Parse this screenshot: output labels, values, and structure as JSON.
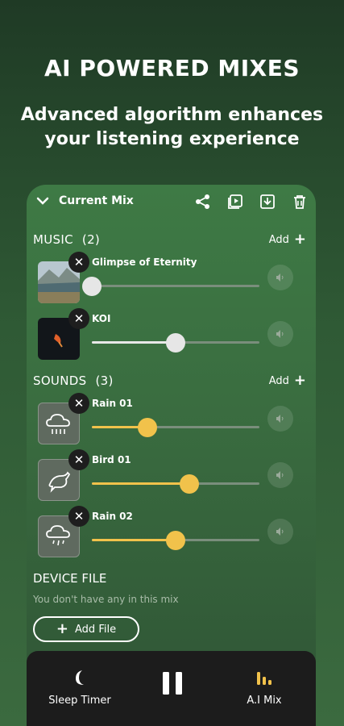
{
  "headline": "AI POWERED MIXES",
  "subhead_line1": "Advanced algorithm enhances",
  "subhead_line2": "your listening experience",
  "panel": {
    "title": "Current Mix",
    "header_icons": [
      "share-icon",
      "playlist-icon",
      "download-icon",
      "trash-icon"
    ]
  },
  "music": {
    "label": "MUSIC",
    "count": "(2)",
    "add_label": "Add",
    "tracks": [
      {
        "name": "Glimpse of Eternity",
        "volume": 0.0
      },
      {
        "name": "KOI",
        "volume": 0.5
      }
    ]
  },
  "sounds": {
    "label": "SOUNDS",
    "count": "(3)",
    "add_label": "Add",
    "tracks": [
      {
        "name": "Rain 01",
        "volume": 0.33,
        "icon": "cloud-rain-icon"
      },
      {
        "name": "Bird 01",
        "volume": 0.58,
        "icon": "bird-icon"
      },
      {
        "name": "Rain 02",
        "volume": 0.5,
        "icon": "cloud-drizzle-icon"
      }
    ]
  },
  "device_file": {
    "label": "DEVICE FILE",
    "empty_text": "You don't have any in this mix",
    "add_label": "Add File"
  },
  "bottom_bar": {
    "sleep_timer": "Sleep Timer",
    "ai_mix": "A.I Mix"
  },
  "colors": {
    "accent_slider": "#f1c24b",
    "music_slider": "#e8e8e8"
  }
}
